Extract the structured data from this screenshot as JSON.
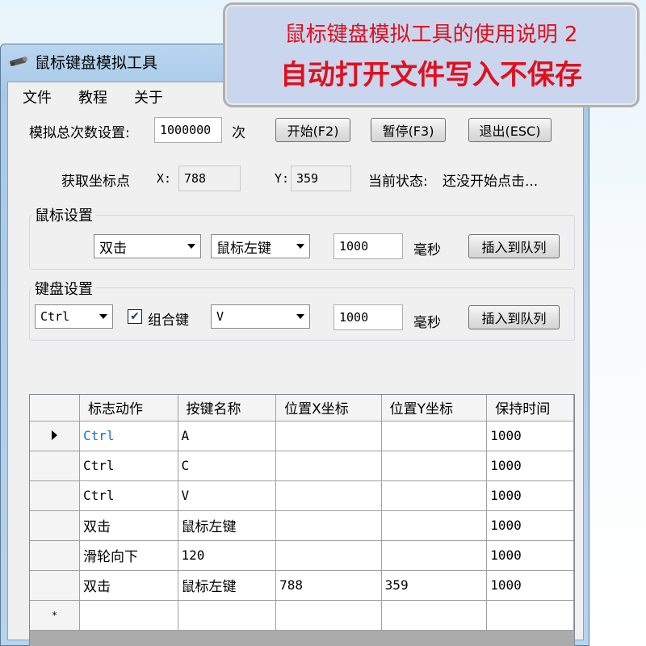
{
  "window": {
    "title": "鼠标键盘模拟工具"
  },
  "menu": [
    "文件",
    "教程",
    "关于"
  ],
  "top": {
    "total_label": "模拟总次数设置:",
    "total_value": "1000000",
    "unit": "次",
    "start_button": "开始(F2)",
    "pause_button": "暂停(F3)",
    "exit_button": "退出(ESC)"
  },
  "coords": {
    "label": "获取坐标点",
    "x_label": "X:",
    "x_value": "788",
    "y_label": "Y:",
    "y_value": "359",
    "status_label": "当前状态:",
    "status_value": "还没开始点击..."
  },
  "mouse": {
    "group_title": "鼠标设置",
    "action": "双击",
    "button": "鼠标左键",
    "delay": "1000",
    "unit": "毫秒",
    "insert_button": "插入到队列"
  },
  "keyboard": {
    "group_title": "键盘设置",
    "modifier": "Ctrl",
    "combo_checked": true,
    "combo_label": "组合键",
    "key": "V",
    "delay": "1000",
    "unit": "毫秒",
    "insert_button": "插入到队列"
  },
  "grid": {
    "columns": [
      "标志动作",
      "按键名称",
      "位置X坐标",
      "位置Y坐标",
      "保持时间"
    ],
    "rows": [
      [
        "Ctrl",
        "A",
        "",
        "",
        "1000"
      ],
      [
        "Ctrl",
        "C",
        "",
        "",
        "1000"
      ],
      [
        "Ctrl",
        "V",
        "",
        "",
        "1000"
      ],
      [
        "双击",
        "鼠标左键",
        "",
        "",
        "1000"
      ],
      [
        "滑轮向下",
        "120",
        "",
        "",
        "1000"
      ],
      [
        "双击",
        "鼠标左键",
        "788",
        "359",
        "1000"
      ]
    ],
    "new_row_marker": "*"
  },
  "banner": {
    "line1": "鼠标键盘模拟工具的使用说明 2",
    "line2": "自动打开文件写入不保存"
  },
  "colors": {
    "banner_text": "#e0101d",
    "selected_cell_text": "#1b6fd1"
  }
}
